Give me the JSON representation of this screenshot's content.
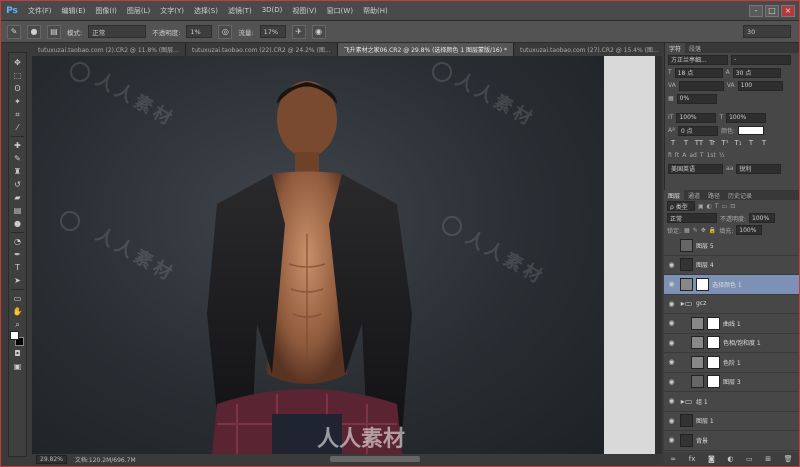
{
  "app": {
    "logo": "Ps",
    "logo_color": "#5fb3ff"
  },
  "menu": [
    "文件(F)",
    "编辑(E)",
    "图像(I)",
    "图层(L)",
    "文字(Y)",
    "选择(S)",
    "滤镜(T)",
    "3D(D)",
    "视图(V)",
    "窗口(W)",
    "帮助(H)"
  ],
  "window_controls": {
    "min": "-",
    "max": "□",
    "close": "×"
  },
  "options_bar": {
    "tool_icon": "brush-icon",
    "brush_size": "",
    "mode_label": "模式:",
    "mode_value": "正常",
    "opacity_label": "不透明度:",
    "opacity_value": "1%",
    "flow_label": "流量:",
    "flow_value": "17%",
    "right_value": "30"
  },
  "tabs": [
    {
      "label": "tutuxuzai.taobao.com (2).CR2 @ 11.8% (图层...",
      "active": false
    },
    {
      "label": "tutuxuzai.taobao.com (22).CR2 @ 24.2% (图...",
      "active": false
    },
    {
      "label": "飞升素材之家06.CR2 @ 29.8% (选择颜色 1 图层蒙版/16) *",
      "active": true
    },
    {
      "label": "tutuxuzai.taobao.com (27).CR2 @ 15.4% (图...",
      "active": false
    }
  ],
  "tools": [
    "move-icon",
    "marquee-icon",
    "lasso-icon",
    "quick-select-icon",
    "crop-icon",
    "eyedropper-icon",
    "heal-icon",
    "brush-icon",
    "stamp-icon",
    "history-brush-icon",
    "eraser-icon",
    "gradient-icon",
    "blur-icon",
    "dodge-icon",
    "pen-icon",
    "type-icon",
    "path-select-icon",
    "shape-icon",
    "hand-icon",
    "zoom-icon"
  ],
  "watermark": {
    "text": "人人素材"
  },
  "statusbar": {
    "zoom": "29.82%",
    "doc": "文档:120.2M/696.7M"
  },
  "character_panel": {
    "tabs": [
      "字符",
      "段落"
    ],
    "font_family": "方正兰亭细...",
    "font_style": "-",
    "size": "18 点",
    "leading": "30 点",
    "kerning": "VA",
    "tracking": "100",
    "scale_pct": "0%",
    "vscale": "100%",
    "hscale": "100%",
    "baseline": "0 点",
    "color_label": "颜色:",
    "type_buttons": [
      "T",
      "T",
      "TT",
      "Tr",
      "T¹",
      "T₁",
      "T",
      "T"
    ],
    "aa_value": "美国英语",
    "aa_method": "锐利"
  },
  "layers_panel": {
    "tabs": [
      "图层",
      "通道",
      "路径",
      "历史记录"
    ],
    "kind_label": "ρ 类型",
    "blend_mode": "正常",
    "opacity_label": "不透明度:",
    "opacity_value": "100%",
    "lock_label": "锁定:",
    "fill_label": "填充:",
    "fill_value": "100%",
    "layers": [
      {
        "name": "图层 5",
        "visible": false,
        "thumb": "thumb",
        "mask": false,
        "active": false
      },
      {
        "name": "图层 4",
        "visible": true,
        "thumb": "dark",
        "mask": false,
        "active": false
      },
      {
        "name": "选择颜色 1",
        "visible": true,
        "thumb": "adj",
        "mask": true,
        "active": true
      },
      {
        "name": "gcz",
        "visible": true,
        "thumb": "folder",
        "mask": false,
        "active": false
      },
      {
        "name": "曲线 1",
        "visible": true,
        "thumb": "adj",
        "mask": true,
        "active": false
      },
      {
        "name": "色相/饱和度 1",
        "visible": true,
        "thumb": "adj",
        "mask": true,
        "active": false
      },
      {
        "name": "色阶 1",
        "visible": true,
        "thumb": "adj",
        "mask": true,
        "active": false
      },
      {
        "name": "图层 3",
        "visible": true,
        "thumb": "thumb",
        "mask": true,
        "active": false
      },
      {
        "name": "组 1",
        "visible": true,
        "thumb": "folder",
        "mask": false,
        "active": false
      },
      {
        "name": "图层 1",
        "visible": true,
        "thumb": "dark",
        "mask": false,
        "active": false
      },
      {
        "name": "背景",
        "visible": true,
        "thumb": "dark",
        "mask": false,
        "active": false
      }
    ],
    "footer_icons": [
      "link-icon",
      "fx-icon",
      "mask-icon",
      "adjustment-icon",
      "folder-icon",
      "new-layer-icon",
      "trash-icon"
    ]
  }
}
